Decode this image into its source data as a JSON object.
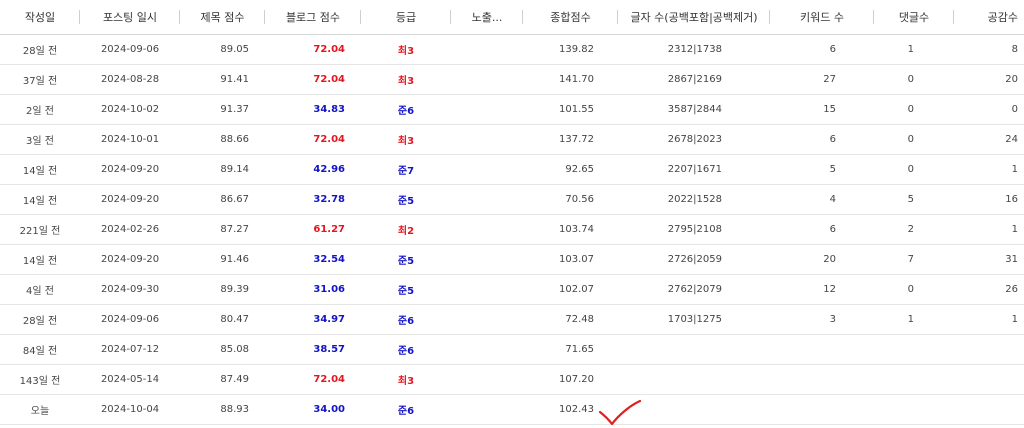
{
  "headers": [
    "작성일",
    "포스팅 일시",
    "제목 점수",
    "블로그 점수",
    "등급",
    "노출...",
    "종합점수",
    "글자 수(공백포함|공백제거)",
    "키워드 수",
    "댓글수",
    "공감수"
  ],
  "colors": {
    "grade_red": "#e8141d",
    "grade_blue": "#1313c8",
    "checkmark": "#e02020"
  },
  "rows": [
    {
      "date": "28일 전",
      "posted": "2024-09-06",
      "title_score": "89.05",
      "blog_score": "72.04",
      "grade": "최3",
      "grade_color": "red",
      "exposure": "",
      "total": "139.82",
      "chars": "2312|1738",
      "keywords": "6",
      "comments": "1",
      "likes": "8"
    },
    {
      "date": "37일 전",
      "posted": "2024-08-28",
      "title_score": "91.41",
      "blog_score": "72.04",
      "grade": "최3",
      "grade_color": "red",
      "exposure": "",
      "total": "141.70",
      "chars": "2867|2169",
      "keywords": "27",
      "comments": "0",
      "likes": "20"
    },
    {
      "date": "2일 전",
      "posted": "2024-10-02",
      "title_score": "91.37",
      "blog_score": "34.83",
      "grade": "준6",
      "grade_color": "blue",
      "exposure": "",
      "total": "101.55",
      "chars": "3587|2844",
      "keywords": "15",
      "comments": "0",
      "likes": "0"
    },
    {
      "date": "3일 전",
      "posted": "2024-10-01",
      "title_score": "88.66",
      "blog_score": "72.04",
      "grade": "최3",
      "grade_color": "red",
      "exposure": "",
      "total": "137.72",
      "chars": "2678|2023",
      "keywords": "6",
      "comments": "0",
      "likes": "24"
    },
    {
      "date": "14일 전",
      "posted": "2024-09-20",
      "title_score": "89.14",
      "blog_score": "42.96",
      "grade": "준7",
      "grade_color": "blue",
      "exposure": "",
      "total": "92.65",
      "chars": "2207|1671",
      "keywords": "5",
      "comments": "0",
      "likes": "1"
    },
    {
      "date": "14일 전",
      "posted": "2024-09-20",
      "title_score": "86.67",
      "blog_score": "32.78",
      "grade": "준5",
      "grade_color": "blue",
      "exposure": "",
      "total": "70.56",
      "chars": "2022|1528",
      "keywords": "4",
      "comments": "5",
      "likes": "16"
    },
    {
      "date": "221일 전",
      "posted": "2024-02-26",
      "title_score": "87.27",
      "blog_score": "61.27",
      "grade": "최2",
      "grade_color": "red",
      "exposure": "",
      "total": "103.74",
      "chars": "2795|2108",
      "keywords": "6",
      "comments": "2",
      "likes": "1"
    },
    {
      "date": "14일 전",
      "posted": "2024-09-20",
      "title_score": "91.46",
      "blog_score": "32.54",
      "grade": "준5",
      "grade_color": "blue",
      "exposure": "",
      "total": "103.07",
      "chars": "2726|2059",
      "keywords": "20",
      "comments": "7",
      "likes": "31"
    },
    {
      "date": "4일 전",
      "posted": "2024-09-30",
      "title_score": "89.39",
      "blog_score": "31.06",
      "grade": "준5",
      "grade_color": "blue",
      "exposure": "",
      "total": "102.07",
      "chars": "2762|2079",
      "keywords": "12",
      "comments": "0",
      "likes": "26"
    },
    {
      "date": "28일 전",
      "posted": "2024-09-06",
      "title_score": "80.47",
      "blog_score": "34.97",
      "grade": "준6",
      "grade_color": "blue",
      "exposure": "",
      "total": "72.48",
      "chars": "1703|1275",
      "keywords": "3",
      "comments": "1",
      "likes": "1"
    },
    {
      "date": "84일 전",
      "posted": "2024-07-12",
      "title_score": "85.08",
      "blog_score": "38.57",
      "grade": "준6",
      "grade_color": "blue",
      "exposure": "",
      "total": "71.65",
      "chars": "",
      "keywords": "",
      "comments": "",
      "likes": ""
    },
    {
      "date": "143일 전",
      "posted": "2024-05-14",
      "title_score": "87.49",
      "blog_score": "72.04",
      "grade": "최3",
      "grade_color": "red",
      "exposure": "",
      "total": "107.20",
      "chars": "",
      "keywords": "",
      "comments": "",
      "likes": ""
    },
    {
      "date": "오늘",
      "posted": "2024-10-04",
      "title_score": "88.93",
      "blog_score": "34.00",
      "grade": "준6",
      "grade_color": "blue",
      "exposure": "",
      "total": "102.43",
      "chars": "",
      "keywords": "",
      "comments": "",
      "likes": ""
    }
  ]
}
